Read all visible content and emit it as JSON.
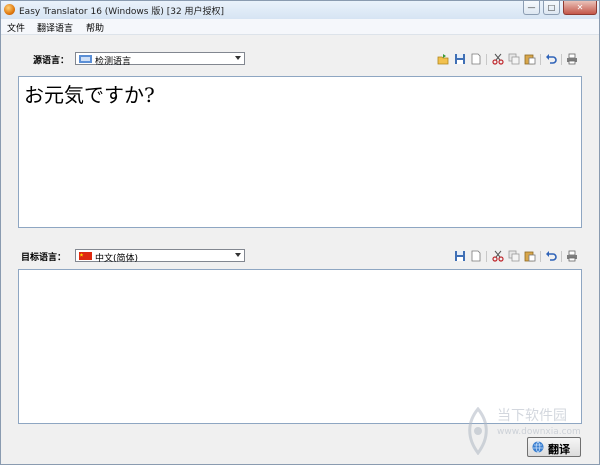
{
  "window": {
    "title": "Easy Translator 16 (Windows 版) [32 用户授权]"
  },
  "menu": {
    "items": [
      "文件",
      "翻译语言",
      "帮助"
    ]
  },
  "source": {
    "label": "源语言：",
    "language": "检测语言",
    "text": "お元気ですか?"
  },
  "target": {
    "label": "目标语言：",
    "language": "中文(简体)",
    "text": ""
  },
  "translate_button": {
    "label": "翻译"
  },
  "watermark": {
    "name": "当下软件园",
    "url": "www.downxia.com"
  },
  "colors": {
    "text_border": "#8ea6c2",
    "window_bg": "#f0f0f0"
  }
}
